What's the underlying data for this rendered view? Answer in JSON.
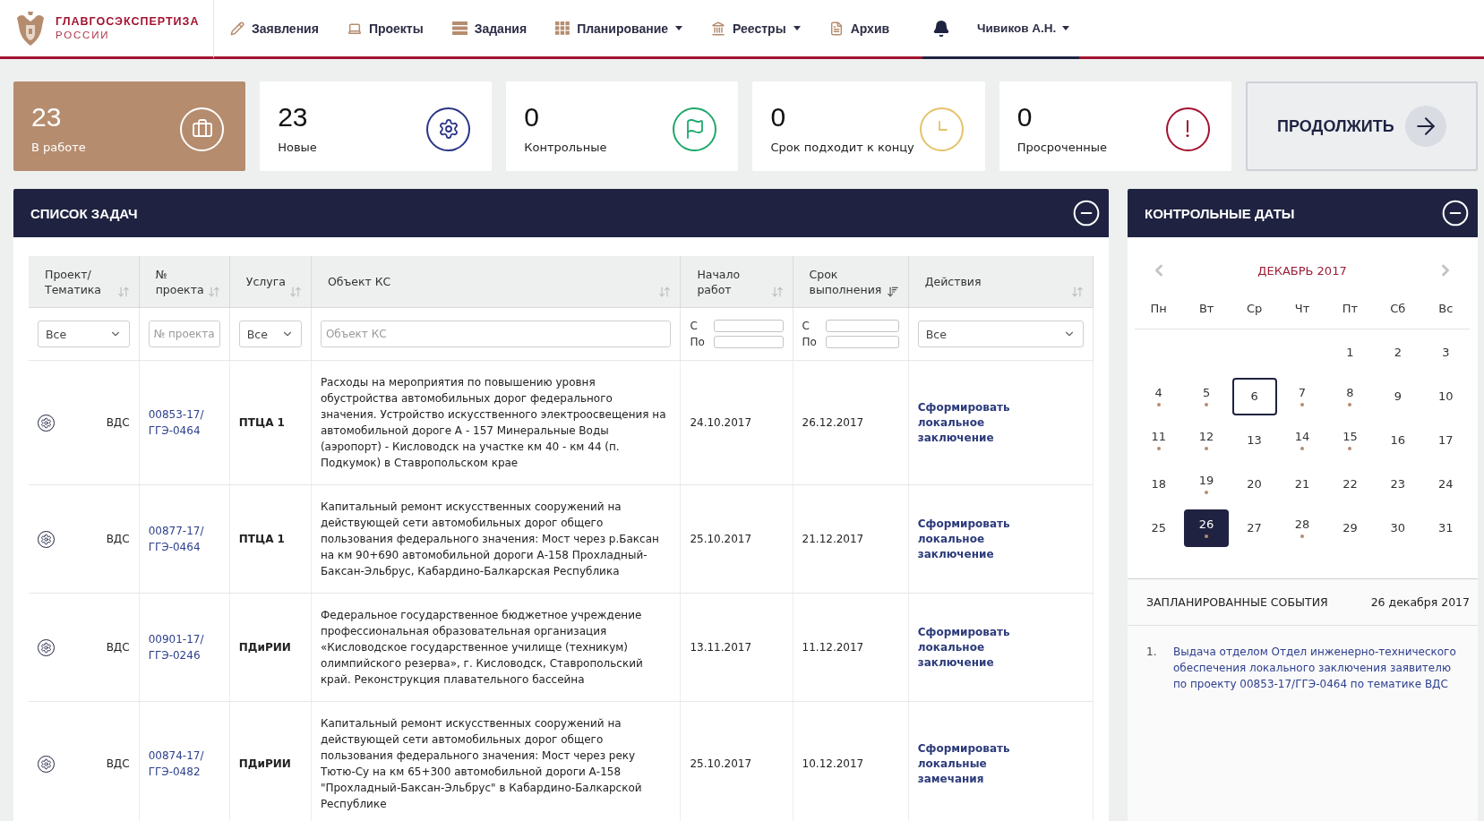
{
  "header": {
    "logo_title": "ГЛАВГОСЭКСПЕРТИЗА",
    "logo_subtitle": "РОССИИ",
    "nav": [
      {
        "label": "Заявления",
        "has_dropdown": false
      },
      {
        "label": "Проекты",
        "has_dropdown": false
      },
      {
        "label": "Задания",
        "has_dropdown": false
      },
      {
        "label": "Планирование",
        "has_dropdown": true
      },
      {
        "label": "Реестры",
        "has_dropdown": true
      },
      {
        "label": "Архив",
        "has_dropdown": false
      }
    ],
    "user": {
      "name": "Чивиков А.Н.",
      "has_dropdown": true
    }
  },
  "stats": [
    {
      "value": "23",
      "label": "В работе",
      "selected": true
    },
    {
      "value": "23",
      "label": "Новые",
      "selected": false,
      "color": "#2a3487"
    },
    {
      "value": "0",
      "label": "Контрольные",
      "selected": false,
      "color": "#1ea86b"
    },
    {
      "value": "0",
      "label": "Срок подходит к концу",
      "selected": false,
      "color": "#e4c26c"
    },
    {
      "value": "0",
      "label": "Просроченные",
      "selected": false,
      "color": "#a3132f"
    }
  ],
  "continue_button": {
    "label": "ПРОДОЛЖИТЬ"
  },
  "tasks": {
    "title": "СПИСОК ЗАДАЧ",
    "expanded": true,
    "columns": [
      {
        "label": "Проект/Тематика",
        "sorted": false
      },
      {
        "label": "№ проекта",
        "sorted": false
      },
      {
        "label": "Услуга",
        "sorted": false
      },
      {
        "label": "Объект КС",
        "sorted": false
      },
      {
        "label": "Начало работ",
        "sorted": false
      },
      {
        "label": "Срок выполнения",
        "sorted": true
      },
      {
        "label": "Действия",
        "sorted": false
      }
    ],
    "filters": [
      {
        "kind": "select",
        "value": "Все"
      },
      {
        "kind": "text",
        "placeholder": "№ проекта"
      },
      {
        "kind": "select",
        "value": "Все"
      },
      {
        "kind": "text",
        "placeholder": "Объект КС"
      },
      {
        "kind": "date_range",
        "from_label": "С",
        "to_label": "По"
      },
      {
        "kind": "date_range",
        "from_label": "С",
        "to_label": "По"
      },
      {
        "kind": "select",
        "value": "Все"
      }
    ],
    "rows": [
      {
        "topic": "ВДС",
        "project_number": "00853-17/ГГЭ-0464",
        "service": "ПТЦА 1",
        "object": "Расходы на мероприятия по повышению уровня обустройства автомобильных дорог федерального значения. Устройство искусственного электроосвещения на автомобильной дороге А - 157 Минеральные Воды (аэропорт) - Кисловодск на участке км 40 - км 44 (п. Подкумок) в Ставропольском крае",
        "start": "24.10.2017",
        "deadline": "26.12.2017",
        "action": "Сформировать локальное заключение"
      },
      {
        "topic": "ВДС",
        "project_number": "00877-17/ГГЭ-0464",
        "service": "ПТЦА 1",
        "object": "Капитальный ремонт искусственных сооружений на действующей сети автомобильных дорог общего пользования федерального значения: Мост через р.Баксан на км 90+690 автомобильной дороги А-158 Прохладный-Баксан-Эльбрус, Кабардино-Балкарская Республика",
        "start": "25.10.2017",
        "deadline": "21.12.2017",
        "action": "Сформировать локальное заключение"
      },
      {
        "topic": "ВДС",
        "project_number": "00901-17/ГГЭ-0246",
        "service": "ПДиРИИ",
        "object": "Федеральное государственное бюджетное учреждение профессиональная образовательная организация «Кисловодское государственное училище (техникум) олимпийского резерва», г. Кисловодск, Ставропольский край. Реконструкция плавательного бассейна",
        "start": "13.11.2017",
        "deadline": "11.12.2017",
        "action": "Сформировать локальное заключение"
      },
      {
        "topic": "ВДС",
        "project_number": "00874-17/ГГЭ-0482",
        "service": "ПДиРИИ",
        "object": "Капитальный ремонт искусственных сооружений на действующей сети автомобильных дорог общего пользования федерального значения: Мост через реку Тютю-Су на км 65+300 автомобильной дороги А-158 \"Прохладный-Баксан-Эльбрус\" в Кабардино-Балкарской Республике",
        "start": "25.10.2017",
        "deadline": "10.12.2017",
        "action": "Сформировать локальные замечания"
      }
    ]
  },
  "calendar": {
    "title": "КОНТРОЛЬНЫЕ ДАТЫ",
    "expanded": true,
    "month": "ДЕКАБРЬ 2017",
    "weekdays": [
      "Пн",
      "Вт",
      "Ср",
      "Чт",
      "Пт",
      "Сб",
      "Вс"
    ],
    "weeks": [
      [
        {
          "day": "1",
          "marked": false,
          "today": false,
          "selected": false
        },
        {
          "day": "2",
          "marked": false,
          "today": false,
          "selected": false
        },
        {
          "day": "3",
          "marked": false,
          "today": false,
          "selected": false
        }
      ],
      [
        {
          "day": "4",
          "marked": true,
          "today": false,
          "selected": false
        },
        {
          "day": "5",
          "marked": true,
          "today": false,
          "selected": false
        },
        {
          "day": "6",
          "marked": false,
          "today": true,
          "selected": false
        },
        {
          "day": "7",
          "marked": true,
          "today": false,
          "selected": false
        },
        {
          "day": "8",
          "marked": true,
          "today": false,
          "selected": false
        },
        {
          "day": "9",
          "marked": false,
          "today": false,
          "selected": false
        },
        {
          "day": "10",
          "marked": false,
          "today": false,
          "selected": false
        }
      ],
      [
        {
          "day": "11",
          "marked": true,
          "today": false,
          "selected": false
        },
        {
          "day": "12",
          "marked": true,
          "today": false,
          "selected": false
        },
        {
          "day": "13",
          "marked": false,
          "today": false,
          "selected": false
        },
        {
          "day": "14",
          "marked": true,
          "today": false,
          "selected": false
        },
        {
          "day": "15",
          "marked": true,
          "today": false,
          "selected": false
        },
        {
          "day": "16",
          "marked": false,
          "today": false,
          "selected": false
        },
        {
          "day": "17",
          "marked": false,
          "today": false,
          "selected": false
        }
      ],
      [
        {
          "day": "18",
          "marked": false,
          "today": false,
          "selected": false
        },
        {
          "day": "19",
          "marked": true,
          "today": false,
          "selected": false
        },
        {
          "day": "20",
          "marked": false,
          "today": false,
          "selected": false
        },
        {
          "day": "21",
          "marked": false,
          "today": false,
          "selected": false
        },
        {
          "day": "22",
          "marked": false,
          "today": false,
          "selected": false
        },
        {
          "day": "23",
          "marked": false,
          "today": false,
          "selected": false
        },
        {
          "day": "24",
          "marked": false,
          "today": false,
          "selected": false
        }
      ],
      [
        {
          "day": "25",
          "marked": false,
          "today": false,
          "selected": false
        },
        {
          "day": "26",
          "marked": true,
          "today": false,
          "selected": true
        },
        {
          "day": "27",
          "marked": false,
          "today": false,
          "selected": false
        },
        {
          "day": "28",
          "marked": true,
          "today": false,
          "selected": false
        },
        {
          "day": "29",
          "marked": false,
          "today": false,
          "selected": false
        },
        {
          "day": "30",
          "marked": false,
          "today": false,
          "selected": false
        },
        {
          "day": "31",
          "marked": false,
          "today": false,
          "selected": false
        }
      ]
    ]
  },
  "events": {
    "title": "ЗАПЛАНИРОВАННЫЕ СОБЫТИЯ",
    "date": "26 декабря 2017",
    "items": [
      {
        "number": "1.",
        "text": "Выдача отделом Отдел инженерно-технического обеспечения локального заключения заявителю по проекту 00853-17/ГГЭ-0464 по тематике ВДС"
      }
    ]
  }
}
